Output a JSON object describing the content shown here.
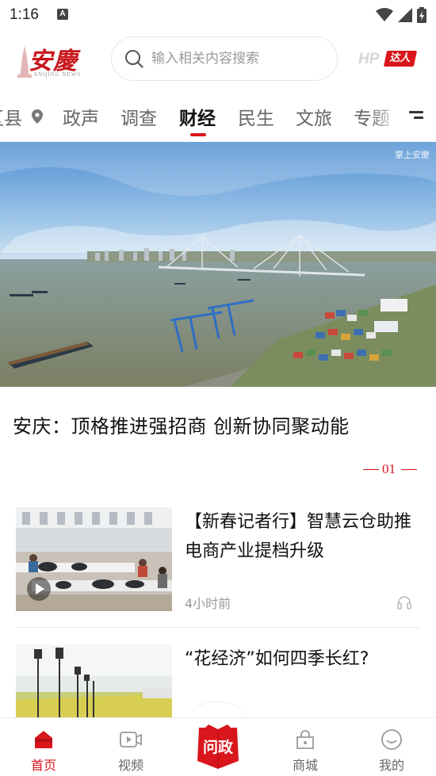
{
  "status_bar": {
    "time": "1:16",
    "notification_icon": "A"
  },
  "header": {
    "logo_text": "安慶",
    "logo_subtext": "ANQING NEWS",
    "search_placeholder": "输入相关内容搜索",
    "hp_text": "HP",
    "hp_badge": "达人"
  },
  "tabs": {
    "items": [
      {
        "label": "区县"
      },
      {
        "label": "政声"
      },
      {
        "label": "调查"
      },
      {
        "label": "财经"
      },
      {
        "label": "民生"
      },
      {
        "label": "文旅"
      },
      {
        "label": "专题"
      }
    ],
    "active": "财经"
  },
  "hero": {
    "watermark": "掌上安慶",
    "title": "安庆：顶格推进强招商 创新协同聚动能",
    "page_indicator": "01"
  },
  "articles": [
    {
      "title": "【新春记者行】智慧云仓助推电商产业提档升级",
      "time": "4小时前",
      "has_video": true
    },
    {
      "title": "“花经济”如何四季长红?"
    }
  ],
  "bottom_nav": {
    "items": [
      {
        "label": "首页",
        "icon": "home-icon"
      },
      {
        "label": "视频",
        "icon": "video-icon"
      },
      {
        "label": "问政",
        "icon": "wenzheng-icon"
      },
      {
        "label": "商城",
        "icon": "shop-icon"
      },
      {
        "label": "我的",
        "icon": "profile-icon"
      }
    ],
    "active": "首页"
  },
  "colors": {
    "accent": "#d9161c",
    "text_primary": "#111111",
    "text_secondary": "#999999"
  }
}
